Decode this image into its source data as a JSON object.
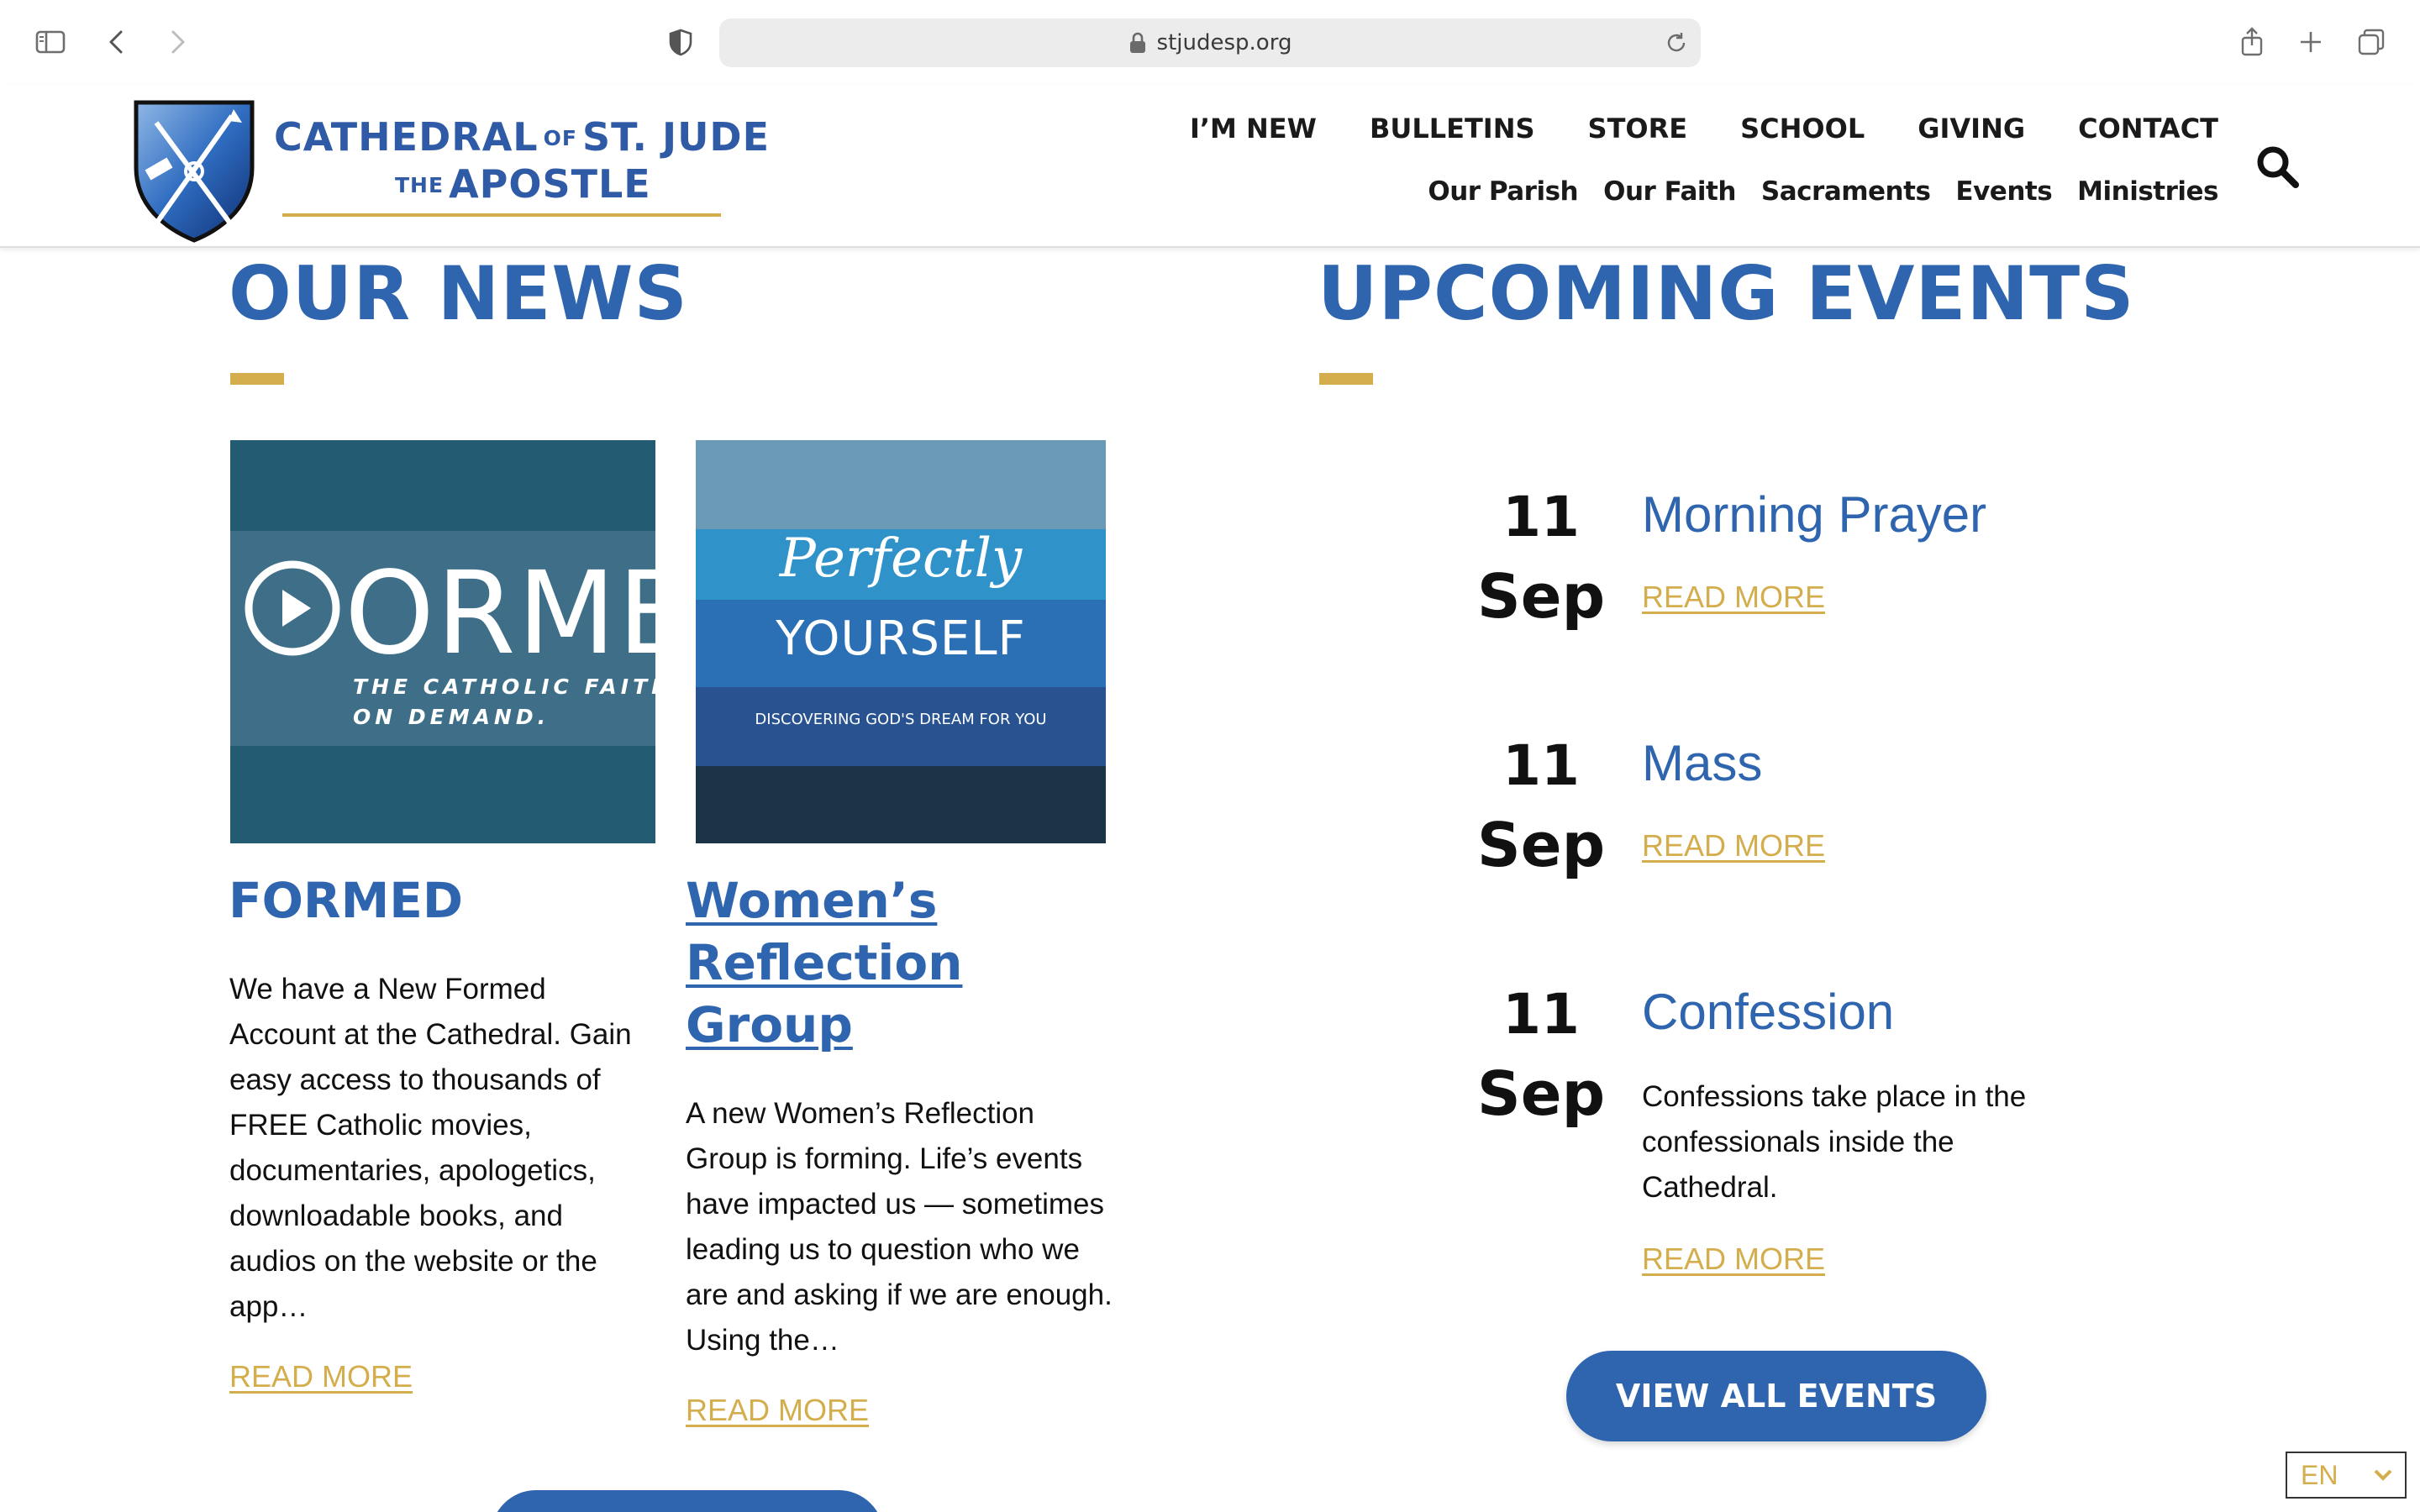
{
  "browser": {
    "url": "stjudesp.org"
  },
  "logo": {
    "line1_a": "CATHEDRAL",
    "line1_small": "OF",
    "line1_b": "ST. JUDE",
    "line2_small": "THE",
    "line2_b": "APOSTLE"
  },
  "nav": {
    "primary": [
      "I’M NEW",
      "BULLETINS",
      "STORE",
      "SCHOOL",
      "GIVING",
      "CONTACT"
    ],
    "secondary": [
      "Our Parish",
      "Our Faith",
      "Sacraments",
      "Events",
      "Ministries"
    ]
  },
  "news": {
    "heading": "OUR NEWS",
    "items": [
      {
        "image_word": "ORMED",
        "image_tag_1": "THE CATHOLIC FAITH",
        "image_tag_2": "ON DEMAND.",
        "title": "FORMED",
        "body": "We have a New Formed Account at the Cathedral. Gain easy access to thousands of FREE Catholic movies, documentaries, apologetics, downloadable books, and audios on the website or the app…",
        "read_more": "READ MORE"
      },
      {
        "image_title": "Perfectly",
        "image_sub": "YOURSELF",
        "image_small": "DISCOVERING GOD'S DREAM FOR YOU",
        "title_1": "Women’s",
        "title_2": "Reflection",
        "title_3": "Group",
        "body": "A new Women’s Reflection Group is forming. Life’s events have impacted us — sometimes leading us to question who we are and asking if we are enough.   Using the…",
        "read_more": "READ MORE"
      }
    ]
  },
  "events": {
    "heading": "UPCOMING EVENTS",
    "items": [
      {
        "day": "11",
        "month": "Sep",
        "title": "Morning Prayer",
        "read_more": "READ MORE"
      },
      {
        "day": "11",
        "month": "Sep",
        "title": "Mass",
        "read_more": "READ MORE"
      },
      {
        "day": "11",
        "month": "Sep",
        "title": "Confession",
        "description": "Confessions take place in the confessionals inside the Cathedral.",
        "read_more": "READ MORE"
      }
    ],
    "view_all": "VIEW ALL EVENTS"
  },
  "language": {
    "selected": "EN"
  },
  "colors": {
    "brand_blue": "#2e65ae",
    "accent_gold": "#d4ad4c"
  }
}
